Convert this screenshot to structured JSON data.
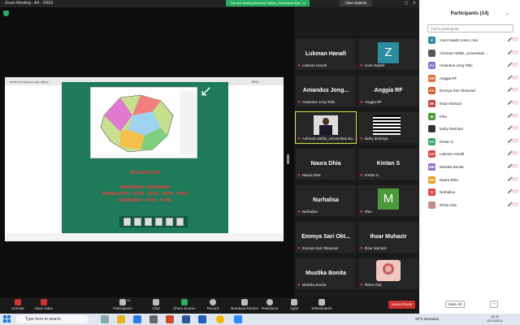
{
  "window": {
    "title": "Zoom Meeting - A4 - VR63",
    "sharing_banner": "You are viewing Achmad Hafidz_Universitas Bak...'s screen",
    "view_options": "View Options"
  },
  "share": {
    "doc_title": "RDTR Kab Nagrang 2 page 099.jpg",
    "zoom_level": "89%",
    "text_lines": [
      "PELUANG KITA",
      "PERTANIAN - PERTANIAN",
      "RUANG KOTA · KOTA · KOTA · KOTA · KOTA",
      "PERTANIAN · KOTA · KOTA"
    ]
  },
  "tiles": [
    {
      "name": "Lukman Hanafi",
      "label": "Lukman Hanafi",
      "type": "text"
    },
    {
      "name": "zoom baa04",
      "label": "Z",
      "type": "avatar",
      "color": "#2a8c9e"
    },
    {
      "name": "Amandus Jong Tallo",
      "label": "Amandus Jong...",
      "type": "text"
    },
    {
      "name": "Anggia RF",
      "label": "Anggia RF",
      "type": "text"
    },
    {
      "name": "Achmad Hafidz_Universitas Ba...",
      "label": "",
      "type": "photo"
    },
    {
      "name": "kathy desintya",
      "label": "",
      "type": "stripes"
    },
    {
      "name": "Naura Dhia",
      "label": "Naura Dhia",
      "type": "text"
    },
    {
      "name": "Kintan S",
      "label": "Kintan S",
      "type": "text"
    },
    {
      "name": "Nurhalisa",
      "label": "Nurhalisa",
      "type": "text"
    },
    {
      "name": "Irfan",
      "label": "M",
      "type": "avatar",
      "color": "#4a9a3a"
    },
    {
      "name": "Emmya Sari Oktaviani",
      "label": "Emmya Sari Okt...",
      "type": "text"
    },
    {
      "name": "Ihsar Muhazir",
      "label": "Ihsar Muhazir",
      "type": "text"
    },
    {
      "name": "Mustika Bonita",
      "label": "Mustika Bonita",
      "type": "text"
    },
    {
      "name": "Rizka Gita",
      "label": "",
      "type": "photo2"
    }
  ],
  "toolbar": {
    "unmute": "Unmute",
    "start_video": "Start Video",
    "participants": "Participants",
    "participants_count": "14",
    "chat": "Chat",
    "share_screen": "Share Screen",
    "record": "Record",
    "breakout": "Breakout Rooms",
    "reactions": "Reactions",
    "apps": "Apps",
    "whiteboards": "Whiteboards",
    "leave": "Leave Room"
  },
  "panel": {
    "title": "Participants (14)",
    "find_placeholder": "Find a participant",
    "mute_all": "Mute All",
    "more": "···",
    "participants": [
      {
        "initials": "Z",
        "name": "zoom baa04 (Host, me)",
        "color": "#2a8c9e"
      },
      {
        "initials": "",
        "name": "Achmad Hafidz_Universitas ...",
        "color": "#555555"
      },
      {
        "initials": "AJ",
        "name": "Amandus Jong Tallo",
        "color": "#8a6fd1"
      },
      {
        "initials": "AR",
        "name": "Anggia RF",
        "color": "#e0703c"
      },
      {
        "initials": "ES",
        "name": "Emmya Sari Oktaviani",
        "color": "#d05a2a"
      },
      {
        "initials": "IM",
        "name": "Ihsar Muhazir",
        "color": "#c94040"
      },
      {
        "initials": "M",
        "name": "Irfan",
        "color": "#4a9a3a"
      },
      {
        "initials": "",
        "name": "kathy desintya",
        "color": "#333333"
      },
      {
        "initials": "KS",
        "name": "Kintan S",
        "color": "#3aa06a"
      },
      {
        "initials": "LH",
        "name": "Lukman Hanafi",
        "color": "#d94545"
      },
      {
        "initials": "MB",
        "name": "Mustika Bonita",
        "color": "#9a6ad0"
      },
      {
        "initials": "ND",
        "name": "Naura Dhia",
        "color": "#e6a020"
      },
      {
        "initials": "N",
        "name": "Nurhalisa",
        "color": "#d94545"
      },
      {
        "initials": "",
        "name": "Rizka Gita",
        "color": "#c88a8a"
      }
    ]
  },
  "taskbar": {
    "search_placeholder": "Type here to search",
    "weather": "28°C Berawan",
    "time": "18:39",
    "date": "11/14/2022"
  }
}
